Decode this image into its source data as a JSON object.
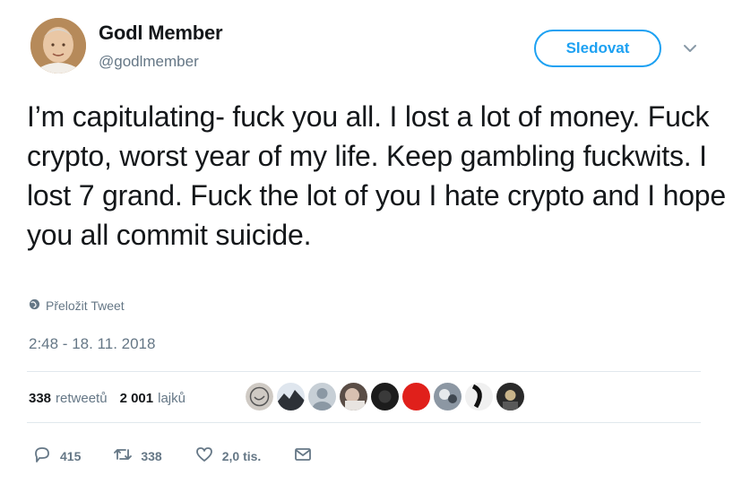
{
  "user": {
    "display_name": "Godl Member",
    "handle": "@godlmember"
  },
  "follow_label": "Sledovat",
  "tweet_text": "I’m capitulating- fuck you all. I lost a lot of money. Fuck crypto, worst year of my life. Keep gambling fuckwits. I lost 7 grand. Fuck the lot of you I hate crypto and I hope you all commit suicide.",
  "translate_label": "Přeložit Tweet",
  "timestamp": "2:48 - 18. 11. 2018",
  "stats": {
    "retweets_count": "338",
    "retweets_label": "retweetů",
    "likes_count": "2 001",
    "likes_label": "lajků"
  },
  "actions": {
    "replies": "415",
    "retweets": "338",
    "likes": "2,0 tis."
  },
  "colors": {
    "accent": "#1da1f2",
    "secondary_text": "#657786",
    "like_avatar_red": "#e0201b"
  },
  "icons": [
    "chevron-down-icon",
    "globe-icon",
    "reply-icon",
    "retweet-icon",
    "heart-icon",
    "message-icon"
  ]
}
